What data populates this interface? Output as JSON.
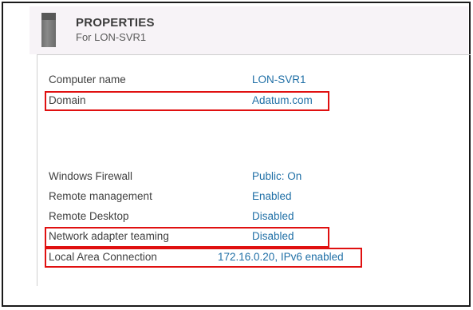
{
  "header": {
    "title": "PROPERTIES",
    "subtitle": "For LON-SVR1"
  },
  "properties": {
    "computer_name": {
      "label": "Computer name",
      "value": "LON-SVR1"
    },
    "domain": {
      "label": "Domain",
      "value": "Adatum.com"
    },
    "windows_firewall": {
      "label": "Windows Firewall",
      "value": "Public: On"
    },
    "remote_management": {
      "label": "Remote management",
      "value": "Enabled"
    },
    "remote_desktop": {
      "label": "Remote Desktop",
      "value": "Disabled"
    },
    "nic_teaming": {
      "label": "Network adapter teaming",
      "value": "Disabled"
    },
    "lan": {
      "label": "Local Area Connection",
      "value": "172.16.0.20, IPv6 enabled"
    }
  },
  "colors": {
    "highlight": "#e01010",
    "link": "#1f6fa6",
    "header_bg": "#f7f3f7"
  },
  "icons": {
    "server": "server-icon"
  }
}
